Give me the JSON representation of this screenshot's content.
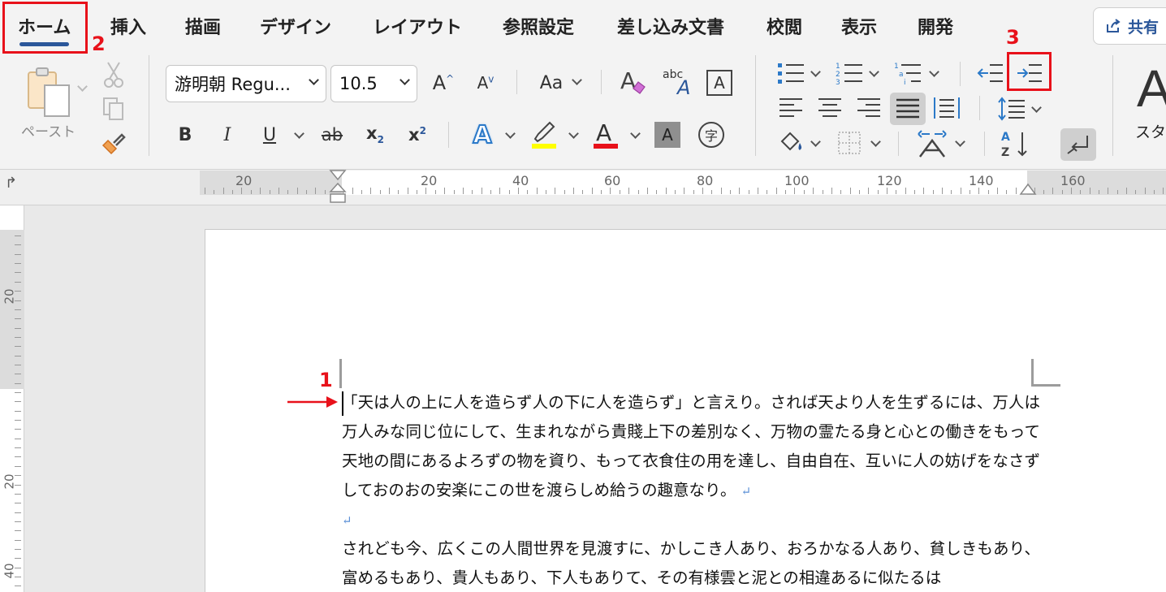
{
  "tabs": [
    {
      "label": "ホーム",
      "active": true
    },
    {
      "label": "挿入"
    },
    {
      "label": "描画"
    },
    {
      "label": "デザイン"
    },
    {
      "label": "レイアウト"
    },
    {
      "label": "参照設定"
    },
    {
      "label": "差し込み文書"
    },
    {
      "label": "校閲"
    },
    {
      "label": "表示"
    },
    {
      "label": "開発"
    }
  ],
  "share_label": "共有",
  "clipboard": {
    "paste_label": "ペースト"
  },
  "font": {
    "name": "游明朝 Regu...",
    "size": "10.5",
    "change_case_label": "Aa",
    "phonetic_label": "abc"
  },
  "format_buttons": {
    "bold": "B",
    "italic": "I",
    "underline": "U",
    "strike": "ab",
    "subscript": "x",
    "superscript": "x",
    "char_shading": "A",
    "enclose": "字"
  },
  "styles": {
    "label": "スタ"
  },
  "ruler": {
    "labels": [
      "20",
      "20",
      "40",
      "60",
      "80",
      "100",
      "120",
      "140",
      "160"
    ]
  },
  "vruler": {
    "labels": [
      "20",
      "20",
      "40"
    ]
  },
  "document": {
    "paragraphs": [
      "「天は人の上に人を造らず人の下に人を造らず」と言えり。されば天より人を生ずるには、万人は万人みな同じ位にして、生まれながら貴賤上下の差別なく、万物の霊たる身と心との働きをもって天地の間にあるよろずの物を資り、もって衣食住の用を達し、自由自在、互いに人の妨げをなさずしておのおの安楽にこの世を渡らしめ給うの趣意なり。",
      "",
      "されども今、広くこの人間世界を見渡すに、かしこき人あり、おろかなる人あり、貧しきもあり、富めるもあり、貴人もあり、下人もありて、その有様雲と泥との相違あるに似たるは"
    ],
    "paragraph_mark": "↵"
  },
  "annotations": {
    "one": "1",
    "two": "2",
    "three": "3"
  },
  "colors": {
    "accent": "#2b579a",
    "annotation": "#e8111a",
    "highlight": "#ffff00",
    "font_color": "#e8111a"
  }
}
